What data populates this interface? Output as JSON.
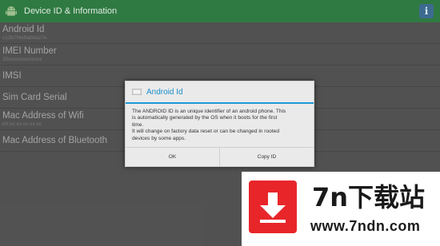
{
  "action_bar": {
    "title": "Device ID & Information",
    "app_icon": "android-icon",
    "info_icon": "info-icon",
    "info_glyph": "i",
    "color": "#2f7a42"
  },
  "list": {
    "items": [
      {
        "label": "Android Id",
        "value": "c13b7f4e9ab8a27e"
      },
      {
        "label": "IMEI Number",
        "value": "35xxxxxxxxxxxxx"
      },
      {
        "label": "IMSI",
        "value": ""
      },
      {
        "label": "Sim Card Serial",
        "value": ""
      },
      {
        "label": "Mac Address of Wifi",
        "value": "b0:xx:xx:xx:xx:xx"
      },
      {
        "label": "Mac Address of Bluetooth",
        "value": ""
      }
    ]
  },
  "dialog": {
    "icon": "android-icon",
    "title": "Android Id",
    "message_line1": "The ANDROID ID is an unique identifier of an android phone. This",
    "message_line2": "is automatically generated by the OS when it boots for the first",
    "message_line3": "time.",
    "message_line4": "It will change on factory data reset or can be changed in rooted",
    "message_line5": "devices by some apps.",
    "ok_label": "OK",
    "copy_label": "Copy ID",
    "accent": "#1b9ad4"
  },
  "watermark": {
    "name": "7n下载站",
    "url": "www.7ndn.com",
    "logo_icon": "download-arrow-icon",
    "brand_color": "#e8262a"
  }
}
